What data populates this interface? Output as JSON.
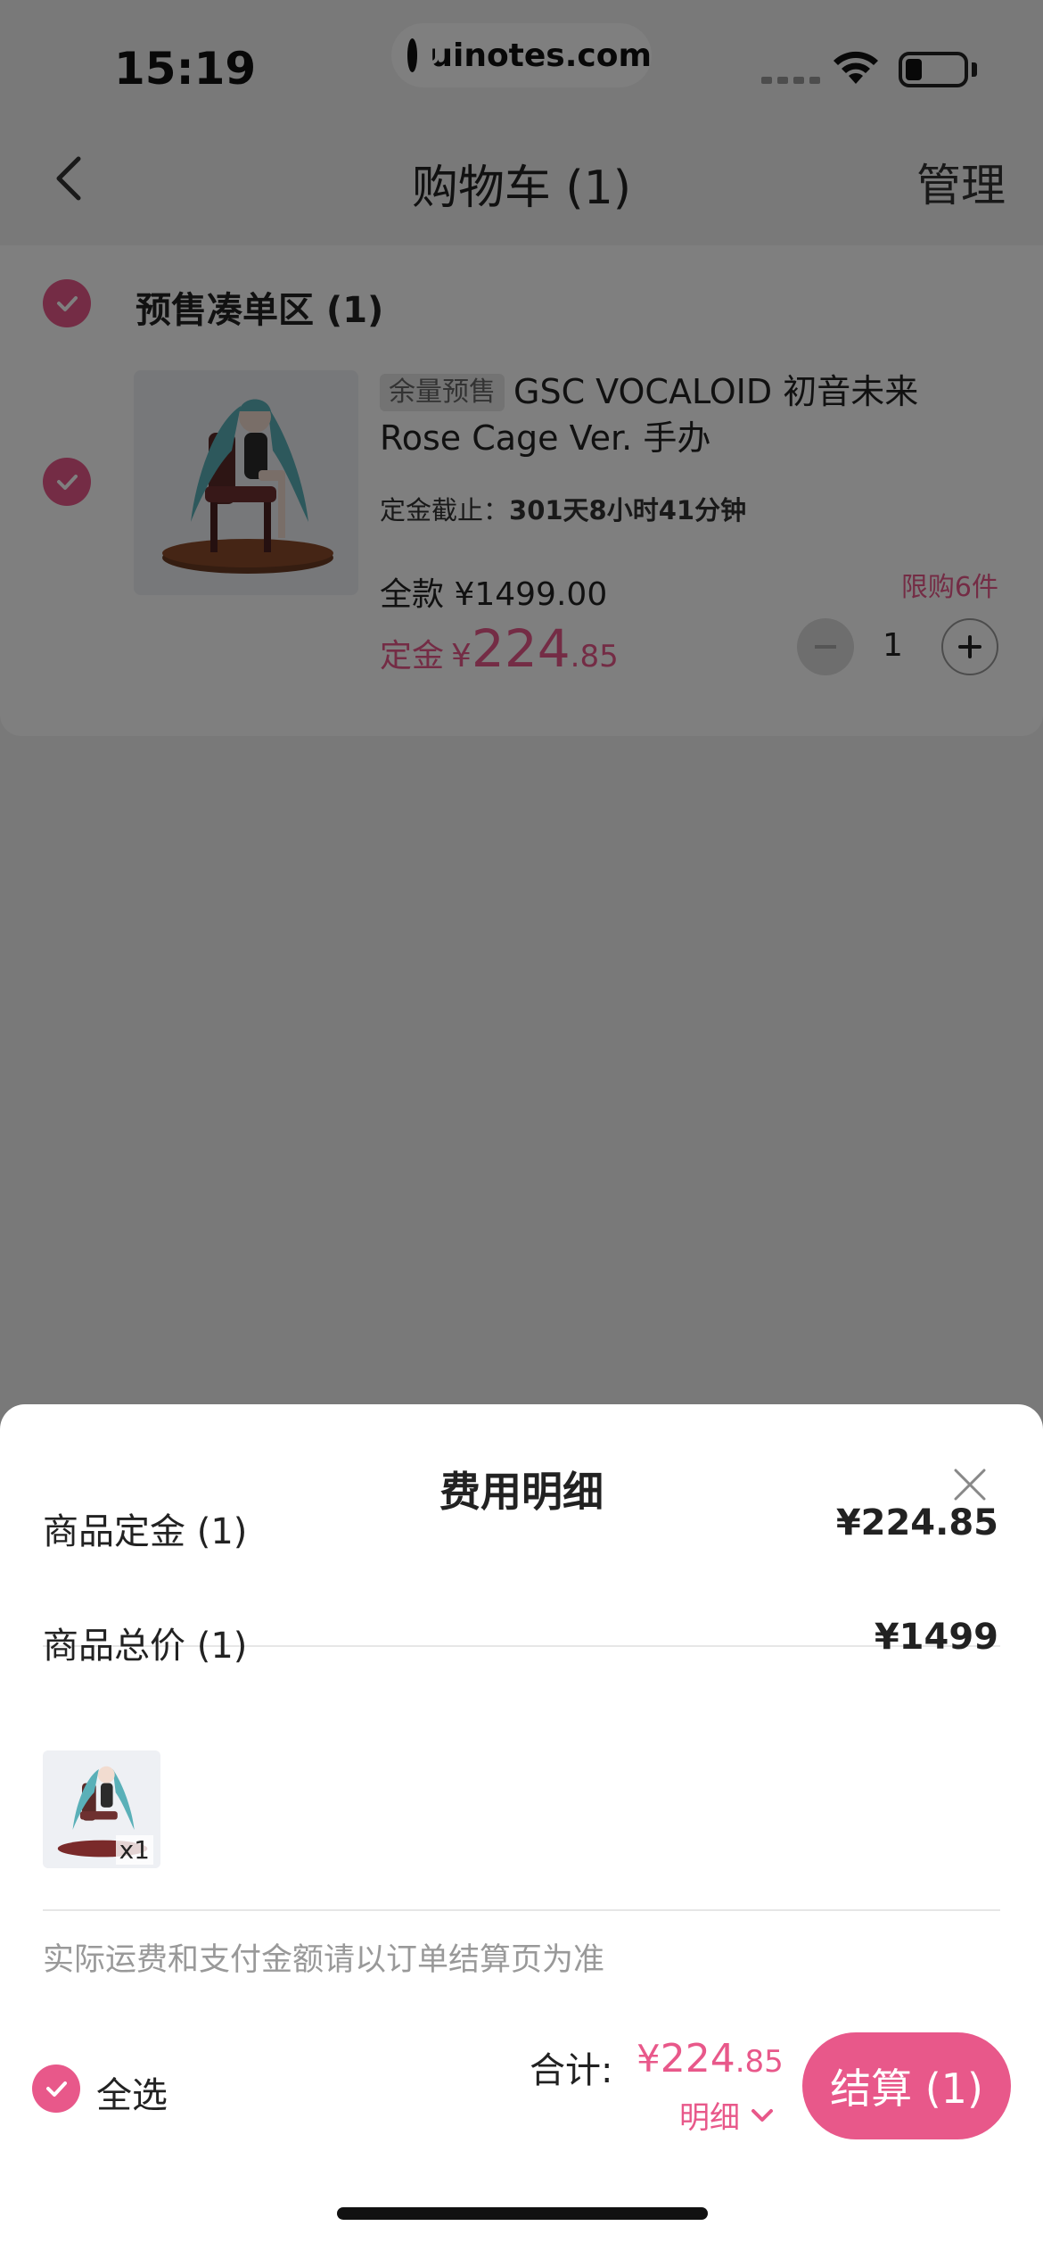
{
  "status_bar": {
    "time": "15:19",
    "watermark": "uinotes.com"
  },
  "navbar": {
    "title": "购物车 (1)",
    "manage_label": "管理"
  },
  "cart": {
    "group_title": "预售凑单区 (1)",
    "item": {
      "presale_tag": "余量预售",
      "name": "GSC VOCALOID 初音未来 Rose Cage Ver. 手办",
      "deadline_label": "定金截止：",
      "deadline_value": "301天8小时41分钟",
      "limit": "限购6件",
      "full_price": "全款 ¥1499.00",
      "deposit_label": "定金",
      "deposit_yen": "¥",
      "deposit_int": "224",
      "deposit_dec": ".85",
      "quantity": "1"
    }
  },
  "sheet": {
    "title": "费用明细",
    "rows": [
      {
        "label": "商品定金 (1)",
        "value": "¥224.85"
      },
      {
        "label": "商品总价 (1)",
        "value": "¥1499"
      }
    ],
    "thumb_qty": "x1",
    "note": "实际运费和支付金额请以订单结算页为准"
  },
  "footer": {
    "select_all": "全选",
    "total_label": "合计:",
    "total_yen": "¥",
    "total_int": "224",
    "total_dec": ".85",
    "detail_label": "明细",
    "checkout_label": "结算 (1)"
  },
  "colors": {
    "accent": "#e8588a",
    "overlay": "rgba(0,0,0,0.5)"
  },
  "icons": [
    "back-arrow-icon",
    "wifi-icon",
    "battery-icon",
    "checkmark-icon",
    "minus-icon",
    "plus-icon",
    "close-icon",
    "chevron-down-icon",
    "uinotes-logo-icon"
  ]
}
